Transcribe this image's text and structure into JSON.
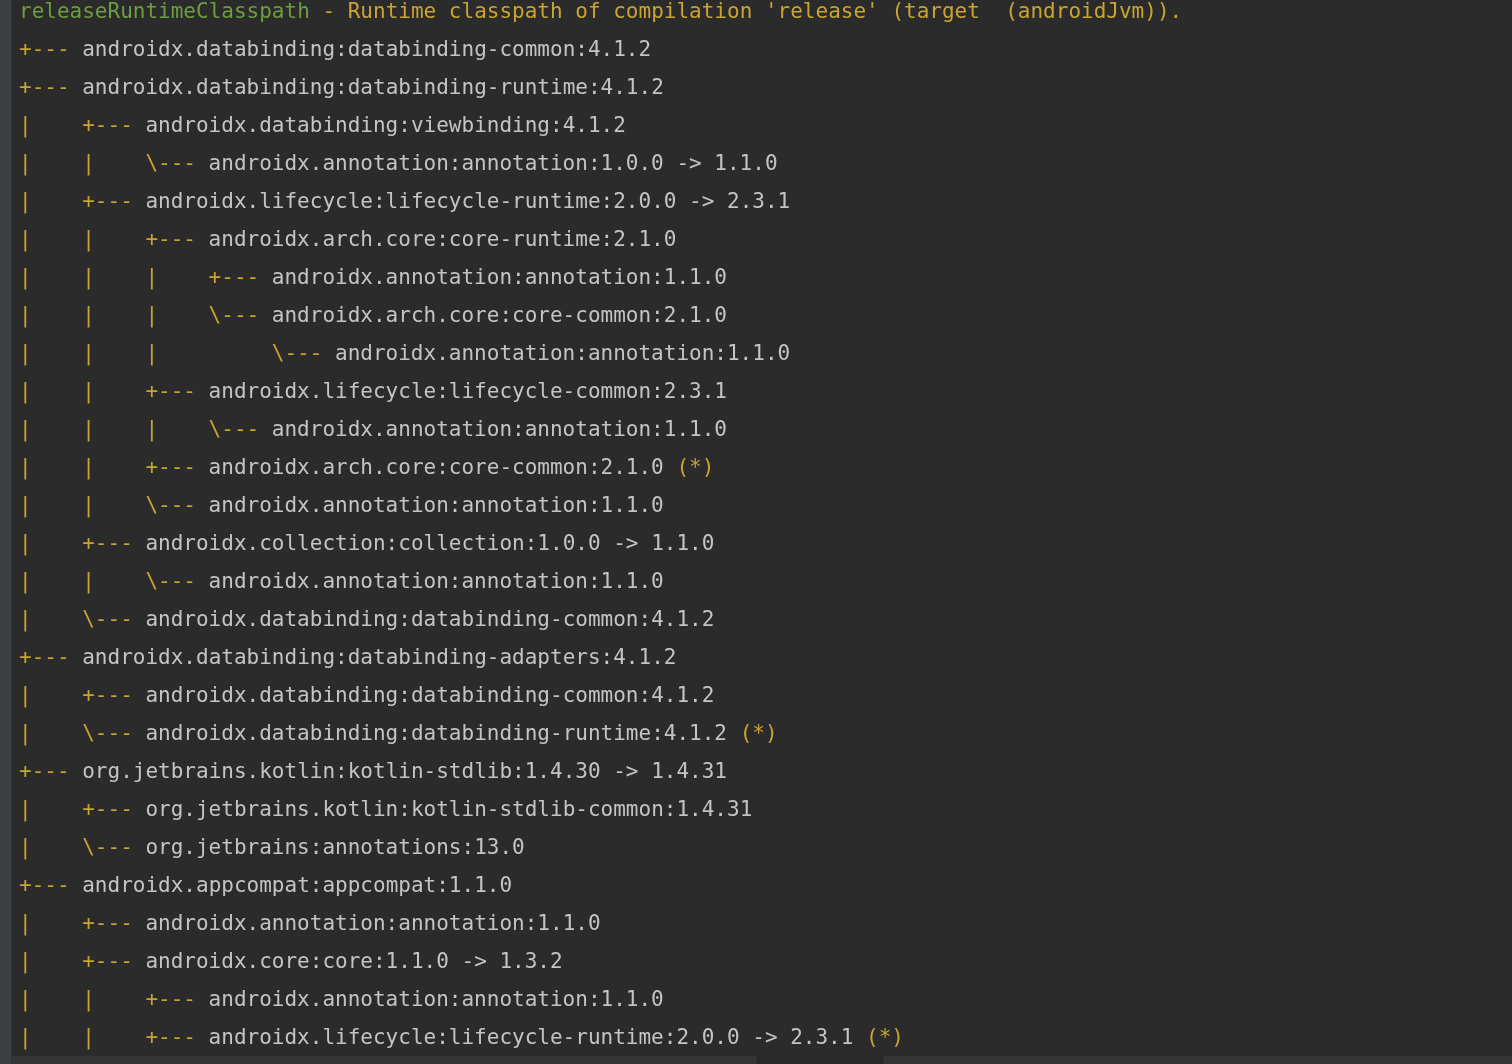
{
  "console": {
    "header": {
      "configuration": "releaseRuntimeClasspath",
      "description": "- Runtime classpath of compilation 'release' (target  (androidJvm))."
    },
    "tree": [
      {
        "branch": "+---",
        "text": "androidx.databinding:databinding-common:4.1.2"
      },
      {
        "branch": "+---",
        "text": "androidx.databinding:databinding-runtime:4.1.2",
        "guide": "|",
        "children": [
          {
            "branch": "+---",
            "text": "androidx.databinding:viewbinding:4.1.2",
            "guide": "|",
            "children": [
              {
                "branch": "\\---",
                "text": "androidx.annotation:annotation:1.0.0 -> 1.1.0"
              }
            ]
          },
          {
            "branch": "+---",
            "text": "androidx.lifecycle:lifecycle-runtime:2.0.0 -> 2.3.1",
            "guide": "|",
            "children": [
              {
                "branch": "+---",
                "text": "androidx.arch.core:core-runtime:2.1.0",
                "guide": "|",
                "children": [
                  {
                    "branch": "+---",
                    "text": "androidx.annotation:annotation:1.1.0"
                  },
                  {
                    "branch": "\\---",
                    "text": "androidx.arch.core:core-common:2.1.0",
                    "children": [
                      {
                        "branch": "\\---",
                        "text": "androidx.annotation:annotation:1.1.0"
                      }
                    ]
                  }
                ]
              },
              {
                "branch": "+---",
                "text": "androidx.lifecycle:lifecycle-common:2.3.1",
                "guide": "|",
                "children": [
                  {
                    "branch": "\\---",
                    "text": "androidx.annotation:annotation:1.1.0"
                  }
                ]
              },
              {
                "branch": "+---",
                "text": "androidx.arch.core:core-common:2.1.0",
                "note": "(*)"
              },
              {
                "branch": "\\---",
                "text": "androidx.annotation:annotation:1.1.0"
              }
            ]
          },
          {
            "branch": "+---",
            "text": "androidx.collection:collection:1.0.0 -> 1.1.0",
            "guide": "|",
            "children": [
              {
                "branch": "\\---",
                "text": "androidx.annotation:annotation:1.1.0"
              }
            ]
          },
          {
            "branch": "\\---",
            "text": "androidx.databinding:databinding-common:4.1.2"
          }
        ]
      },
      {
        "branch": "+---",
        "text": "androidx.databinding:databinding-adapters:4.1.2",
        "guide": "|",
        "children": [
          {
            "branch": "+---",
            "text": "androidx.databinding:databinding-common:4.1.2"
          },
          {
            "branch": "\\---",
            "text": "androidx.databinding:databinding-runtime:4.1.2",
            "note": "(*)"
          }
        ]
      },
      {
        "branch": "+---",
        "text": "org.jetbrains.kotlin:kotlin-stdlib:1.4.30 -> 1.4.31",
        "guide": "|",
        "children": [
          {
            "branch": "+---",
            "text": "org.jetbrains.kotlin:kotlin-stdlib-common:1.4.31"
          },
          {
            "branch": "\\---",
            "text": "org.jetbrains:annotations:13.0"
          }
        ]
      },
      {
        "branch": "+---",
        "text": "androidx.appcompat:appcompat:1.1.0",
        "guide": "|",
        "children": [
          {
            "branch": "+---",
            "text": "androidx.annotation:annotation:1.1.0"
          },
          {
            "branch": "+---",
            "text": "androidx.core:core:1.1.0 -> 1.3.2",
            "guide": "|",
            "children": [
              {
                "branch": "+---",
                "text": "androidx.annotation:annotation:1.1.0"
              },
              {
                "branch": "+---",
                "text": "androidx.lifecycle:lifecycle-runtime:2.0.0 -> 2.3.1",
                "note": "(*)"
              }
            ]
          }
        ]
      }
    ]
  }
}
